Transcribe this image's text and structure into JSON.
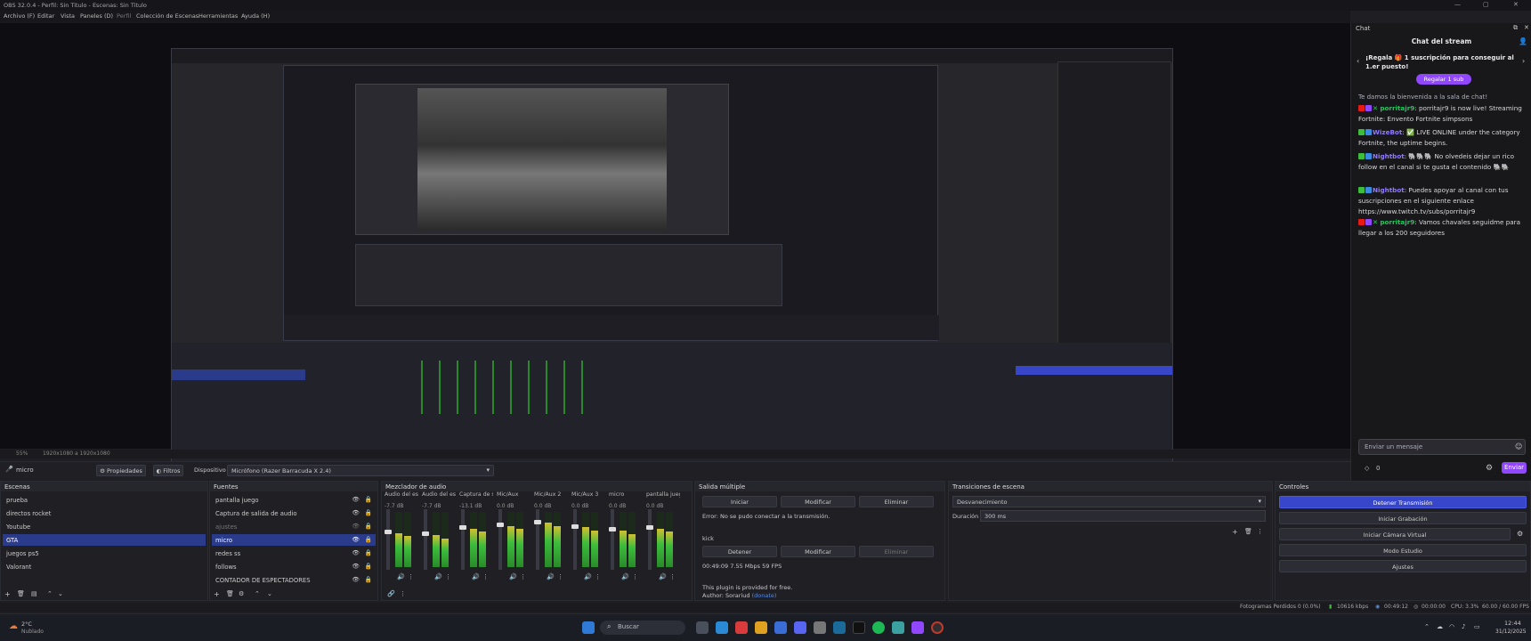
{
  "window": {
    "title": "OBS 32.0.4 - Perfil: Sin Titulo - Escenas: Sin Titulo"
  },
  "menu": [
    "Archivo (F)",
    "Editar",
    "Vista",
    "Paneles (D)",
    "Perfil",
    "Colección de Escenas",
    "Herramientas",
    "Ayuda (H)"
  ],
  "zoom": {
    "label": "55%",
    "size": "1920x1080 a 1920x1080"
  },
  "toolbar": {
    "source_name": "micro",
    "properties": "Propiedades",
    "filters": "Filtros",
    "device_label": "Dispositivo",
    "device_value": "Micrófono (Razer Barracuda X 2.4)"
  },
  "docks": {
    "scenes": {
      "title": "Escenas",
      "items": [
        "prueba",
        "directos rocket",
        "Youtube",
        "GTA",
        "juegos ps5",
        "Valorant"
      ],
      "selected": 3
    },
    "sources": {
      "title": "Fuentes",
      "items": [
        "pantalla juego",
        "Captura de salida de audio",
        "ajustes",
        "micro",
        "redes ss",
        "follows",
        "CONTADOR DE ESPECTADORES"
      ],
      "selected": 3
    },
    "mixer": {
      "title": "Mezclador de audio",
      "channels": [
        {
          "name": "Audio del escritorio",
          "db": "-7.7 dB",
          "level": 0.62
        },
        {
          "name": "Audio del escritorio",
          "db": "-7.7 dB",
          "level": 0.58
        },
        {
          "name": "Captura de salida d",
          "db": "-13.1 dB",
          "level": 0.7
        },
        {
          "name": "Mic/Aux",
          "db": "0.0 dB",
          "level": 0.75
        },
        {
          "name": "Mic/Aux 2",
          "db": "0.0 dB",
          "level": 0.8
        },
        {
          "name": "Mic/Aux 3",
          "db": "0.0 dB",
          "level": 0.72
        },
        {
          "name": "micro",
          "db": "0.0 dB",
          "level": 0.66
        },
        {
          "name": "pantalla juego",
          "db": "0.0 dB",
          "level": 0.7
        }
      ]
    },
    "multi": {
      "title": "Salida múltiple",
      "btn1": "Iniciar",
      "btn2": "Modificar",
      "btn3": "Eliminar",
      "error": "Error: No se pudo conectar a la transmisión.",
      "kick": "kick",
      "btn4": "Detener",
      "btn5": "Modificar",
      "btn6": "Eliminar",
      "stats": "00:49:09  7.55 Mbps  59 FPS",
      "note1": "This plugin is provided for free.",
      "note2": "Author: Sorariud ",
      "note2link": "(donate)"
    },
    "transitions": {
      "title": "Transiciones de escena",
      "value": "Desvanecimiento",
      "duration_label": "Duración",
      "duration_value": "300 ms"
    },
    "controls": {
      "title": "Controles",
      "buttons": [
        "Detener Transmisión",
        "Iniciar Grabación",
        "Iniciar Cámara Virtual",
        "Modo Estudio",
        "Ajustes"
      ]
    }
  },
  "chat": {
    "header": "Chat",
    "title": "Chat del stream",
    "promo": "¡Regala 🎁 1 suscripción para conseguir al 1.er puesto!",
    "gift_button": "Regalar 1 sub",
    "welcome": "Te damos la bienvenida a la sala de chat!",
    "messages": [
      {
        "user": "porritajr9",
        "color": "#1fc75c",
        "text": ": porritajr9 is now live! Streaming Fortnite: Envento Fortnite simpsons"
      },
      {
        "user": "WizeBot",
        "color": "#8f7bff",
        "text": ": ✅ LIVE ONLINE under the category Fortnite, the uptime begins."
      },
      {
        "user": "Nightbot",
        "color": "#8f7bff",
        "text": ": 🐘🐘🐘 No olvedeis dejar un rico follow en el canal si te gusta el contenido 🐘🐘"
      },
      {
        "user": "Nightbot",
        "color": "#8f7bff",
        "text": ": Puedes apoyar al canal con tus suscripciones en el siguiente enlace https://www.twitch.tv/subs/porritajr9"
      },
      {
        "user": "porritajr9",
        "color": "#1fc75c",
        "text": ": Vamos chavales seguidme para llegar a los 200 seguidores"
      }
    ],
    "input_placeholder": "Enviar un mensaje",
    "points": "0",
    "send": "Enviar"
  },
  "status": {
    "dropped": "Fotogramas Perdidos 0 (0.0%)",
    "bitrate": "10616 kbps",
    "live_time": "00:49:12",
    "rec_time": "00:00:00",
    "cpu": "CPU: 3.3%",
    "fps": "60.00 / 60.00 FPS"
  },
  "taskbar": {
    "weather_temp": "2°C",
    "weather_desc": "Nublado",
    "search": "Buscar",
    "time": "12:44",
    "date": "31/12/2025"
  },
  "colors": {
    "accent": "#3847c9",
    "twitch": "#9147ff",
    "green": "#3cbd3c"
  }
}
